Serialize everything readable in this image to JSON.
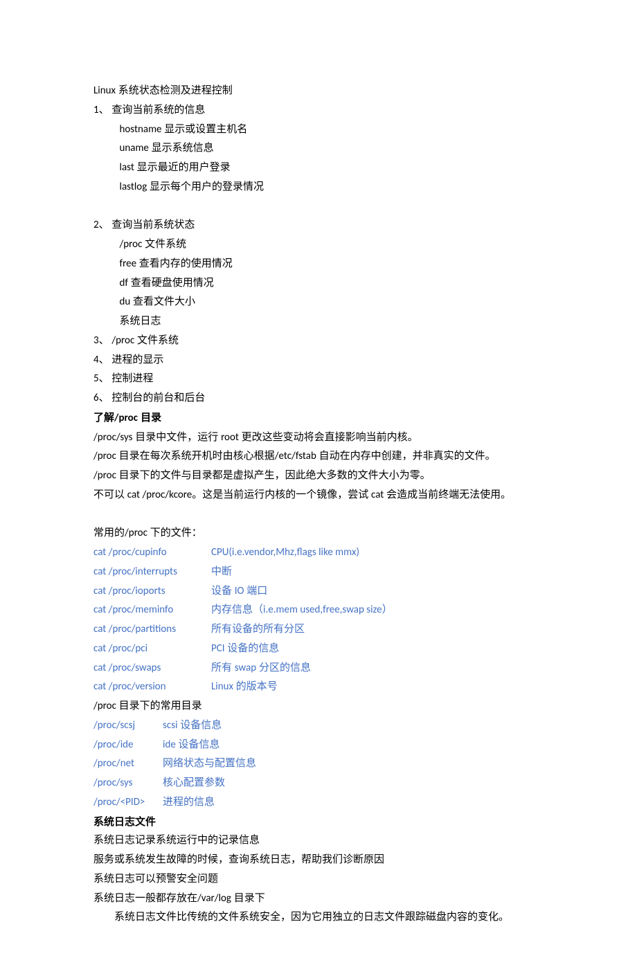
{
  "title_prefix": "Linux",
  "title_suffix": " 系统状态检测及进程控制",
  "items": [
    {
      "num": "1",
      "label": "查询当前系统的信息",
      "subs": [
        {
          "pre": "hostname",
          "txt": " 显示或设置主机名"
        },
        {
          "pre": "uname",
          "txt": " 显示系统信息"
        },
        {
          "pre": "last",
          "txt": " 显示最近的用户登录"
        },
        {
          "pre": "lastlog",
          "txt": " 显示每个用户的登录情况"
        }
      ]
    },
    {
      "num": "2",
      "label": "查询当前系统状态",
      "subs": [
        {
          "pre": "/proc",
          "txt": " 文件系统"
        },
        {
          "pre": "free",
          "txt": " 查看内存的使用情况"
        },
        {
          "pre": "df",
          "txt": " 查看硬盘使用情况"
        },
        {
          "pre": "du",
          "txt": " 查看文件大小"
        },
        {
          "pre": "",
          "txt": "系统日志"
        }
      ]
    },
    {
      "num": "3",
      "pre": "/proc",
      "label": " 文件系统"
    },
    {
      "num": "4",
      "label": "进程的显示"
    },
    {
      "num": "5",
      "label": "控制进程"
    },
    {
      "num": "6",
      "label": "控制台的前台和后台"
    }
  ],
  "h1_pre": "了解",
  "h1_mid": "/proc",
  "h1_suf": " 目录",
  "proc_notes": [
    {
      "parts": [
        {
          "t": "/proc/sys",
          "latin": true
        },
        {
          "t": " 目录中文件，运行 "
        },
        {
          "t": "root",
          "latin": true
        },
        {
          "t": " 更改这些变动将会直接影响当前内核。"
        }
      ]
    },
    {
      "parts": [
        {
          "t": "/proc",
          "latin": true
        },
        {
          "t": " 目录在每次系统开机时由核心根据"
        },
        {
          "t": "/etc/fstab",
          "latin": true
        },
        {
          "t": " 自动在内存中创建，并非真实的文件。"
        }
      ]
    },
    {
      "parts": [
        {
          "t": "/proc",
          "latin": true
        },
        {
          "t": " 目录下的文件与目录都是虚拟产生，因此绝大多数的文件大小为零。"
        }
      ]
    },
    {
      "parts": [
        {
          "t": "不可以 "
        },
        {
          "t": "cat /proc/kcore",
          "latin": true
        },
        {
          "t": "。这是当前运行内核的一个镜像，尝试 "
        },
        {
          "t": "cat",
          "latin": true
        },
        {
          "t": " 会造成当前终端无法使用。"
        }
      ]
    }
  ],
  "common_label_pre": "常用的",
  "common_label_mid": "/proc",
  "common_label_suf": " 下的文件：",
  "proc_files": [
    {
      "cmd": "cat /proc/cupinfo",
      "desc": "CPU(i.e.vendor,Mhz,flags like mmx)",
      "desc_latin": true
    },
    {
      "cmd": "cat /proc/interrupts",
      "desc": "中断"
    },
    {
      "cmd": "cat /proc/ioports",
      "desc_pre": "设备 ",
      "desc_mid": "IO",
      "desc_suf": " 端口"
    },
    {
      "cmd": "cat /proc/meminfo",
      "desc_pre": "内存信息（",
      "desc_mid": "i.e.mem used,free,swap size",
      "desc_suf": "）"
    },
    {
      "cmd": "cat /proc/partitions",
      "desc": "所有设备的所有分区"
    },
    {
      "cmd": "cat /proc/pci",
      "desc_mid": "PCI",
      "desc_suf": " 设备的信息"
    },
    {
      "cmd": "cat /proc/swaps",
      "desc_pre": "所有 ",
      "desc_mid": "swap",
      "desc_suf": " 分区的信息"
    },
    {
      "cmd": "cat /proc/version",
      "desc_mid": "Linux",
      "desc_suf": " 的版本号"
    }
  ],
  "dir_label_pre": "/proc",
  "dir_label_suf": " 目录下的常用目录",
  "proc_dirs": [
    {
      "path": "/proc/scsj",
      "desc_mid": "scsi",
      "desc_suf": " 设备信息"
    },
    {
      "path": "/proc/ide",
      "desc_mid": "ide",
      "desc_suf": " 设备信息"
    },
    {
      "path": "/proc/net",
      "desc": "网络状态与配置信息"
    },
    {
      "path": "/proc/sys",
      "desc": "核心配置参数"
    },
    {
      "path": "/proc/<PID>",
      "desc": "进程的信息"
    }
  ],
  "h2": "系统日志文件",
  "log_lines": [
    "系统日志记录系统运行中的记录信息",
    "服务或系统发生故障的时候，查询系统日志，帮助我们诊断原因",
    "系统日志可以预警安全问题"
  ],
  "log_line4_pre": "系统日志一般都存放在",
  "log_line4_mid": "/var/log",
  "log_line4_suf": " 目录下",
  "log_indent": "系统日志文件比传统的文件系统安全，因为它用独立的日志文件跟踪磁盘内容的变化。"
}
